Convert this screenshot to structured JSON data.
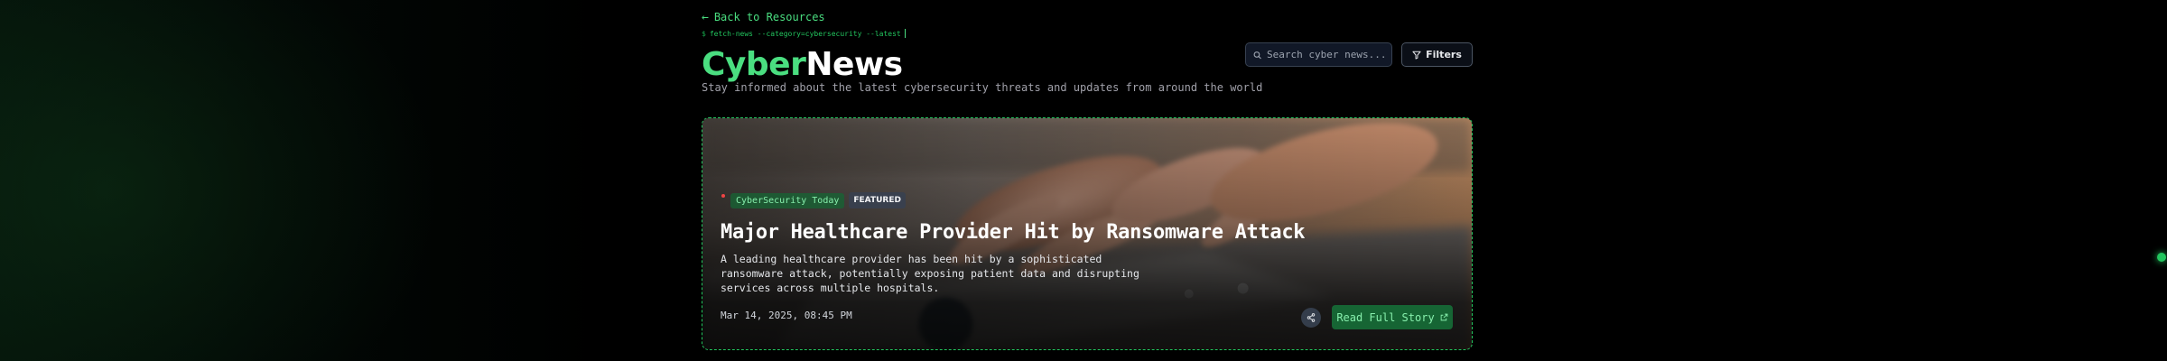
{
  "nav": {
    "back_label": "Back to Resources",
    "back_arrow": "←"
  },
  "terminal": {
    "prompt": "$",
    "command": "fetch-news --category=cybersecurity --latest"
  },
  "brand": {
    "part1": "Cyber",
    "part2": "News",
    "tagline": "Stay informed about the latest cybersecurity threats and updates from around the world"
  },
  "search": {
    "placeholder": "Search cyber news...",
    "value": ""
  },
  "filters": {
    "label": "Filters"
  },
  "featured": {
    "source": "CyberSecurity Today",
    "badge": "FEATURED",
    "title": "Major Healthcare Provider Hit by Ransomware Attack",
    "summary": "A leading healthcare provider has been hit by a sophisticated ransomware attack, potentially exposing patient data and disrupting services across multiple hospitals.",
    "date": "Mar 14, 2025, 08:45 PM",
    "read_label": "Read Full Story"
  },
  "colors": {
    "accent": "#4ade80",
    "accent_dark": "#166534",
    "background": "#000000",
    "card_border": "#22c55e"
  },
  "icons": {
    "back": "arrow-left-icon",
    "search": "search-icon",
    "filters": "filter-icon",
    "share": "share-icon",
    "external": "external-link-icon"
  }
}
